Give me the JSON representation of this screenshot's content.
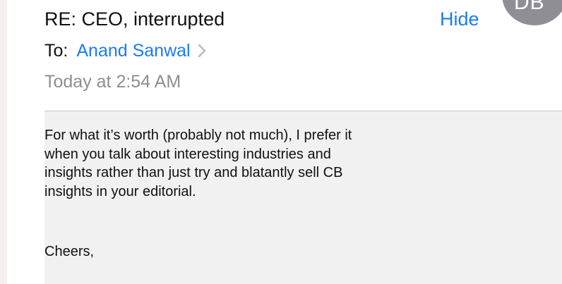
{
  "email": {
    "subject": "RE: CEO, interrupted",
    "hide_label": "Hide",
    "avatar_initials": "DB",
    "to_label": "To:",
    "to_name": "Anand Sanwal",
    "date": "Today at 2:54 AM",
    "body_lines": [
      "For what it’s worth (probably not much), I prefer it",
      "when you talk about interesting industries and",
      "insights rather than just try and blatantly sell CB",
      "insights in your editorial."
    ],
    "signoff": "Cheers,"
  },
  "colors": {
    "link_blue": "#1a7cf0",
    "meta_gray": "#8e8e93",
    "avatar_gray": "#8e8e94",
    "body_background": "#f1f1f1"
  },
  "icons": {
    "recipient_chevron": "chevron-right-icon"
  }
}
